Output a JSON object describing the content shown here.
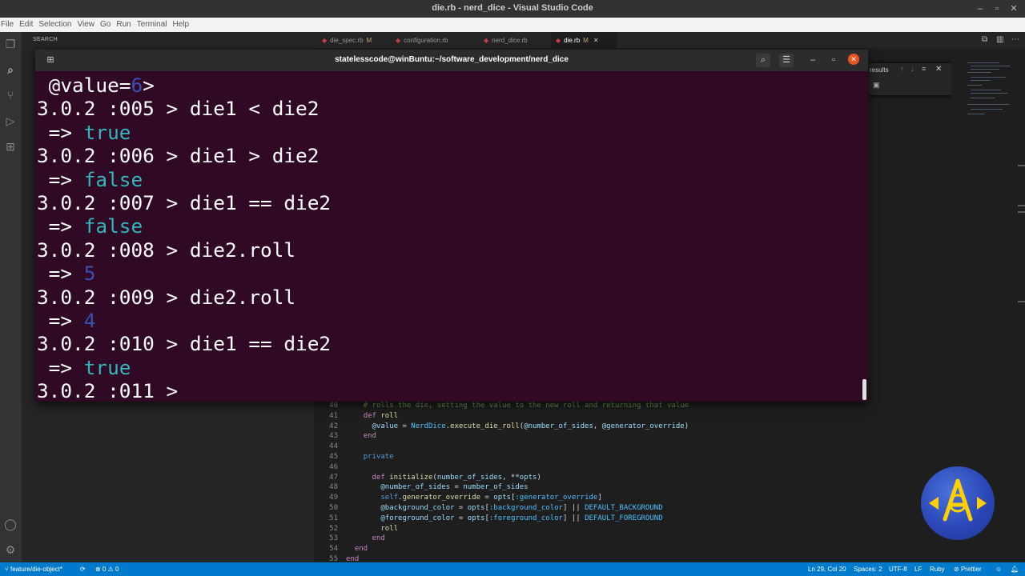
{
  "window": {
    "title": "die.rb - nerd_dice - Visual Studio Code",
    "controls": [
      "–",
      "▫",
      "✕"
    ]
  },
  "menu": [
    "File",
    "Edit",
    "Selection",
    "View",
    "Go",
    "Run",
    "Terminal",
    "Help"
  ],
  "sidebar": {
    "title": "SEARCH"
  },
  "tabs": [
    {
      "label": "die_spec.rb",
      "modified": "M"
    },
    {
      "label": "configuration.rb",
      "modified": ""
    },
    {
      "label": "nerd_dice.rb",
      "modified": ""
    },
    {
      "label": "die.rb",
      "modified": "M",
      "active": true
    }
  ],
  "find_widget": {
    "label": "results"
  },
  "terminal": {
    "title": "statelesscode@winBuntu:~/software_development/nerd_dice",
    "lines": [
      {
        "kind": "attr",
        "prefix": " @value=",
        "value": "6",
        "suffix": ">"
      },
      {
        "kind": "cmd",
        "text": "3.0.2 :005 > die1 < die2"
      },
      {
        "kind": "res",
        "arrow": " => ",
        "value": "true",
        "type": "bool"
      },
      {
        "kind": "cmd",
        "text": "3.0.2 :006 > die1 > die2"
      },
      {
        "kind": "res",
        "arrow": " => ",
        "value": "false",
        "type": "bool"
      },
      {
        "kind": "cmd",
        "text": "3.0.2 :007 > die1 == die2"
      },
      {
        "kind": "res",
        "arrow": " => ",
        "value": "false",
        "type": "bool"
      },
      {
        "kind": "cmd",
        "text": "3.0.2 :008 > die2.roll"
      },
      {
        "kind": "res",
        "arrow": " => ",
        "value": "5",
        "type": "num"
      },
      {
        "kind": "cmd",
        "text": "3.0.2 :009 > die2.roll"
      },
      {
        "kind": "res",
        "arrow": " => ",
        "value": "4",
        "type": "num"
      },
      {
        "kind": "cmd",
        "text": "3.0.2 :010 > die1 == die2"
      },
      {
        "kind": "res",
        "arrow": " => ",
        "value": "true",
        "type": "bool"
      },
      {
        "kind": "cmd",
        "text": "3.0.2 :011 > "
      }
    ]
  },
  "code": {
    "lines": [
      {
        "n": "40",
        "html": "    <span class=\"cm\"># rolls the die, setting the value to the new roll and returning that value</span>"
      },
      {
        "n": "41",
        "html": "    <span class=\"kw\">def</span> <span class=\"fn\">roll</span>"
      },
      {
        "n": "42",
        "html": "      <span class=\"iv\">@value</span> = <span class=\"cst\">NerdDice</span>.<span class=\"fn\">execute_die_roll</span>(<span class=\"iv\">@number_of_sides</span>, <span class=\"iv\">@generator_override</span>)"
      },
      {
        "n": "43",
        "html": "    <span class=\"kw\">end</span>"
      },
      {
        "n": "44",
        "html": ""
      },
      {
        "n": "45",
        "html": "    <span class=\"kw2\">private</span>"
      },
      {
        "n": "46",
        "html": ""
      },
      {
        "n": "47",
        "html": "      <span class=\"kw\">def</span> <span class=\"fn\">initialize</span>(<span class=\"iv\">number_of_sides</span>, **<span class=\"iv\">opts</span>)"
      },
      {
        "n": "48",
        "html": "        <span class=\"iv\">@number_of_sides</span> = <span class=\"iv\">number_of_sides</span>"
      },
      {
        "n": "49",
        "html": "        <span class=\"kw2\">self</span>.<span class=\"fn\">generator_override</span> = <span class=\"iv\">opts</span>[<span class=\"sym\">:generator_override</span>]"
      },
      {
        "n": "50",
        "html": "        <span class=\"iv\">@background_color</span> = <span class=\"iv\">opts</span>[<span class=\"sym\">:background_color</span>] || <span class=\"cst\">DEFAULT_BACKGROUND</span>"
      },
      {
        "n": "51",
        "html": "        <span class=\"iv\">@foreground_color</span> = <span class=\"iv\">opts</span>[<span class=\"sym\">:foreground_color</span>] || <span class=\"cst\">DEFAULT_FOREGROUND</span>"
      },
      {
        "n": "52",
        "html": "        <span class=\"fn\">roll</span>"
      },
      {
        "n": "53",
        "html": "      <span class=\"kw\">end</span>"
      },
      {
        "n": "54",
        "html": "  <span class=\"kw\">end</span>"
      },
      {
        "n": "55",
        "html": "<span class=\"kw\">end</span>"
      }
    ]
  },
  "status": {
    "branch": "feature/die-object*",
    "sync": "⟳",
    "problems": "⊗ 0 ⚠ 0",
    "position": "Ln 29, Col 20",
    "spaces": "Spaces: 2",
    "encoding": "UTF-8",
    "eol": "LF",
    "language": "Ruby",
    "formatter": "Prettier"
  },
  "colors": {
    "terminal_bg": "#300a24",
    "bool": "#34b5bd",
    "number": "#3a4fb3",
    "status_bar": "#007acc"
  }
}
